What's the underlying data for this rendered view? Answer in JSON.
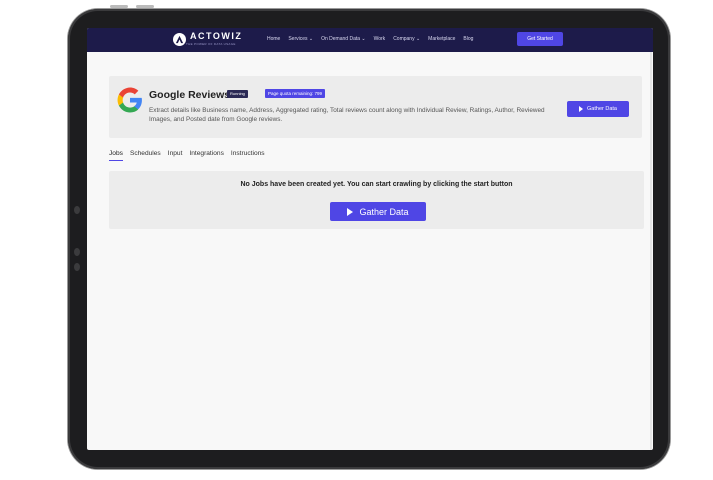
{
  "navbar": {
    "brand": "ACTOWIZ",
    "tagline": "THE POWER OF DATA USAGE",
    "links": [
      "Home",
      "Services ⌄",
      "On Demand Data ⌄",
      "Work",
      "Company ⌄",
      "Marketplace",
      "Blog"
    ],
    "cta_label": "Get Started"
  },
  "product": {
    "title": "Google Reviews",
    "status_badge": "Running",
    "quota_badge": "Page quota remaining: 799",
    "description": "Extract details like Business name, Address, Aggregated rating, Total reviews count along with Individual Review, Ratings, Author, Reviewed Images, and Posted date from Google reviews.",
    "gather_label": "Gather Data"
  },
  "tabs": [
    "Jobs",
    "Schedules",
    "Input",
    "Integrations",
    "Instructions"
  ],
  "active_tab": "Jobs",
  "jobs": {
    "empty_message": "No Jobs have been created yet. You can start crawling by clicking the start button",
    "gather_label": "Gather Data"
  },
  "colors": {
    "accent": "#4f46e5",
    "navbar_bg": "#1d1b4a",
    "panel_bg": "#ececec"
  }
}
